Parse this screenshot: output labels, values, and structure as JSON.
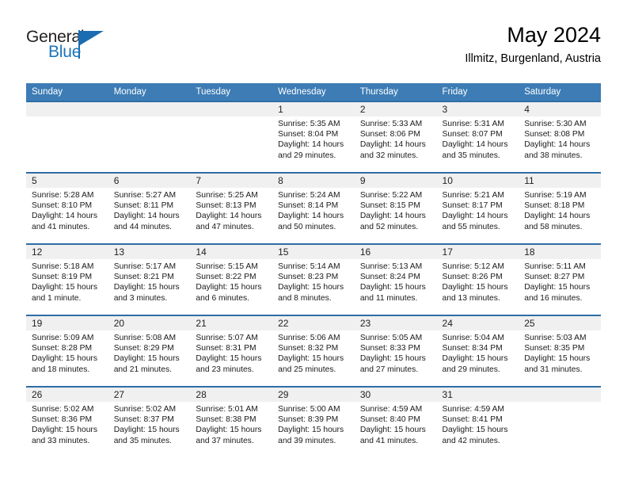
{
  "brand": {
    "line1": "General",
    "line2": "Blue",
    "triangle_color": "#1b6cb0"
  },
  "header": {
    "title": "May 2024",
    "location": "Illmitz, Burgenland, Austria"
  },
  "theme": {
    "header_bg": "#3d7cb5",
    "row_border": "#2e6da4",
    "daynum_bg": "#f0f0f0"
  },
  "columns": [
    "Sunday",
    "Monday",
    "Tuesday",
    "Wednesday",
    "Thursday",
    "Friday",
    "Saturday"
  ],
  "weeks": [
    [
      {
        "day": "",
        "lines": []
      },
      {
        "day": "",
        "lines": []
      },
      {
        "day": "",
        "lines": []
      },
      {
        "day": "1",
        "lines": [
          "Sunrise: 5:35 AM",
          "Sunset: 8:04 PM",
          "Daylight: 14 hours",
          "and 29 minutes."
        ]
      },
      {
        "day": "2",
        "lines": [
          "Sunrise: 5:33 AM",
          "Sunset: 8:06 PM",
          "Daylight: 14 hours",
          "and 32 minutes."
        ]
      },
      {
        "day": "3",
        "lines": [
          "Sunrise: 5:31 AM",
          "Sunset: 8:07 PM",
          "Daylight: 14 hours",
          "and 35 minutes."
        ]
      },
      {
        "day": "4",
        "lines": [
          "Sunrise: 5:30 AM",
          "Sunset: 8:08 PM",
          "Daylight: 14 hours",
          "and 38 minutes."
        ]
      }
    ],
    [
      {
        "day": "5",
        "lines": [
          "Sunrise: 5:28 AM",
          "Sunset: 8:10 PM",
          "Daylight: 14 hours",
          "and 41 minutes."
        ]
      },
      {
        "day": "6",
        "lines": [
          "Sunrise: 5:27 AM",
          "Sunset: 8:11 PM",
          "Daylight: 14 hours",
          "and 44 minutes."
        ]
      },
      {
        "day": "7",
        "lines": [
          "Sunrise: 5:25 AM",
          "Sunset: 8:13 PM",
          "Daylight: 14 hours",
          "and 47 minutes."
        ]
      },
      {
        "day": "8",
        "lines": [
          "Sunrise: 5:24 AM",
          "Sunset: 8:14 PM",
          "Daylight: 14 hours",
          "and 50 minutes."
        ]
      },
      {
        "day": "9",
        "lines": [
          "Sunrise: 5:22 AM",
          "Sunset: 8:15 PM",
          "Daylight: 14 hours",
          "and 52 minutes."
        ]
      },
      {
        "day": "10",
        "lines": [
          "Sunrise: 5:21 AM",
          "Sunset: 8:17 PM",
          "Daylight: 14 hours",
          "and 55 minutes."
        ]
      },
      {
        "day": "11",
        "lines": [
          "Sunrise: 5:19 AM",
          "Sunset: 8:18 PM",
          "Daylight: 14 hours",
          "and 58 minutes."
        ]
      }
    ],
    [
      {
        "day": "12",
        "lines": [
          "Sunrise: 5:18 AM",
          "Sunset: 8:19 PM",
          "Daylight: 15 hours",
          "and 1 minute."
        ]
      },
      {
        "day": "13",
        "lines": [
          "Sunrise: 5:17 AM",
          "Sunset: 8:21 PM",
          "Daylight: 15 hours",
          "and 3 minutes."
        ]
      },
      {
        "day": "14",
        "lines": [
          "Sunrise: 5:15 AM",
          "Sunset: 8:22 PM",
          "Daylight: 15 hours",
          "and 6 minutes."
        ]
      },
      {
        "day": "15",
        "lines": [
          "Sunrise: 5:14 AM",
          "Sunset: 8:23 PM",
          "Daylight: 15 hours",
          "and 8 minutes."
        ]
      },
      {
        "day": "16",
        "lines": [
          "Sunrise: 5:13 AM",
          "Sunset: 8:24 PM",
          "Daylight: 15 hours",
          "and 11 minutes."
        ]
      },
      {
        "day": "17",
        "lines": [
          "Sunrise: 5:12 AM",
          "Sunset: 8:26 PM",
          "Daylight: 15 hours",
          "and 13 minutes."
        ]
      },
      {
        "day": "18",
        "lines": [
          "Sunrise: 5:11 AM",
          "Sunset: 8:27 PM",
          "Daylight: 15 hours",
          "and 16 minutes."
        ]
      }
    ],
    [
      {
        "day": "19",
        "lines": [
          "Sunrise: 5:09 AM",
          "Sunset: 8:28 PM",
          "Daylight: 15 hours",
          "and 18 minutes."
        ]
      },
      {
        "day": "20",
        "lines": [
          "Sunrise: 5:08 AM",
          "Sunset: 8:29 PM",
          "Daylight: 15 hours",
          "and 21 minutes."
        ]
      },
      {
        "day": "21",
        "lines": [
          "Sunrise: 5:07 AM",
          "Sunset: 8:31 PM",
          "Daylight: 15 hours",
          "and 23 minutes."
        ]
      },
      {
        "day": "22",
        "lines": [
          "Sunrise: 5:06 AM",
          "Sunset: 8:32 PM",
          "Daylight: 15 hours",
          "and 25 minutes."
        ]
      },
      {
        "day": "23",
        "lines": [
          "Sunrise: 5:05 AM",
          "Sunset: 8:33 PM",
          "Daylight: 15 hours",
          "and 27 minutes."
        ]
      },
      {
        "day": "24",
        "lines": [
          "Sunrise: 5:04 AM",
          "Sunset: 8:34 PM",
          "Daylight: 15 hours",
          "and 29 minutes."
        ]
      },
      {
        "day": "25",
        "lines": [
          "Sunrise: 5:03 AM",
          "Sunset: 8:35 PM",
          "Daylight: 15 hours",
          "and 31 minutes."
        ]
      }
    ],
    [
      {
        "day": "26",
        "lines": [
          "Sunrise: 5:02 AM",
          "Sunset: 8:36 PM",
          "Daylight: 15 hours",
          "and 33 minutes."
        ]
      },
      {
        "day": "27",
        "lines": [
          "Sunrise: 5:02 AM",
          "Sunset: 8:37 PM",
          "Daylight: 15 hours",
          "and 35 minutes."
        ]
      },
      {
        "day": "28",
        "lines": [
          "Sunrise: 5:01 AM",
          "Sunset: 8:38 PM",
          "Daylight: 15 hours",
          "and 37 minutes."
        ]
      },
      {
        "day": "29",
        "lines": [
          "Sunrise: 5:00 AM",
          "Sunset: 8:39 PM",
          "Daylight: 15 hours",
          "and 39 minutes."
        ]
      },
      {
        "day": "30",
        "lines": [
          "Sunrise: 4:59 AM",
          "Sunset: 8:40 PM",
          "Daylight: 15 hours",
          "and 41 minutes."
        ]
      },
      {
        "day": "31",
        "lines": [
          "Sunrise: 4:59 AM",
          "Sunset: 8:41 PM",
          "Daylight: 15 hours",
          "and 42 minutes."
        ]
      },
      {
        "day": "",
        "lines": []
      }
    ]
  ]
}
